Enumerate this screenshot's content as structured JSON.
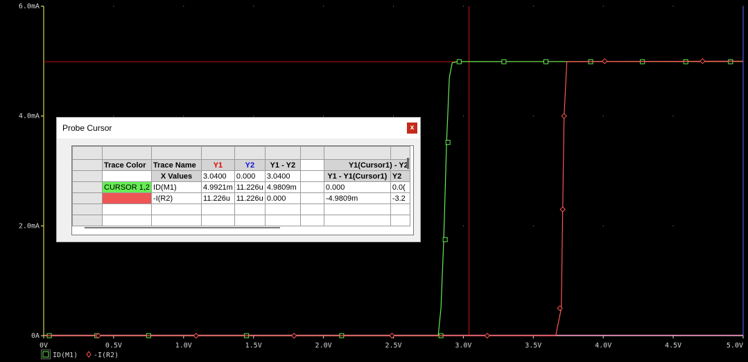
{
  "chart_data": {
    "type": "line",
    "xlim": [
      0,
      5.0
    ],
    "ylim": [
      0,
      6.0
    ],
    "x_ticks": [
      0,
      0.5,
      1.0,
      1.5,
      2.0,
      2.5,
      3.0,
      3.5,
      4.0,
      4.5,
      5.0
    ],
    "x_tick_labels": [
      "0V",
      "0.5V",
      "1.0V",
      "1.5V",
      "2.0V",
      "2.5V",
      "3.0V",
      "3.5V",
      "4.0V",
      "4.5V",
      "5.0V"
    ],
    "y_ticks": [
      0,
      2.0,
      4.0,
      6.0
    ],
    "y_tick_labels": [
      "0A",
      "2.0mA",
      "4.0mA",
      "6.0mA"
    ],
    "grid_dots": true,
    "cursors": {
      "x": 3.04,
      "y": 4.99
    },
    "series": [
      {
        "name": "ID(M1)",
        "color": "#66ee55",
        "marker": "square",
        "x": [
          0,
          2.82,
          2.84,
          2.86,
          2.88,
          2.9,
          2.92,
          2.96,
          3.04,
          5.0
        ],
        "y": [
          0,
          0,
          0.5,
          1.75,
          3.52,
          4.7,
          4.97,
          4.99,
          4.992,
          4.995
        ],
        "marker_x": [
          0.04,
          0.38,
          0.75,
          1.45,
          2.13,
          2.84,
          2.87,
          2.89,
          2.97,
          3.29,
          3.59,
          3.91,
          4.28,
          4.59,
          4.91
        ],
        "marker_y": [
          0,
          0,
          0,
          0,
          0,
          0,
          1.75,
          3.52,
          4.99,
          4.99,
          4.99,
          4.99,
          4.99,
          4.99,
          4.99
        ]
      },
      {
        "name": "-I(R2)",
        "color": "#ff5555",
        "marker": "diamond",
        "x": [
          0,
          3.66,
          3.7,
          3.71,
          3.72,
          3.74,
          5.0
        ],
        "y": [
          0,
          0,
          0.5,
          2.3,
          4.0,
          4.99,
          5.0
        ],
        "marker_x": [
          0.39,
          1.09,
          1.79,
          2.49,
          3.17,
          3.69,
          3.71,
          3.72,
          4.01,
          4.71
        ],
        "marker_y": [
          0,
          0,
          0,
          0,
          0,
          0.5,
          2.3,
          4.0,
          5.0,
          5.0
        ]
      }
    ]
  },
  "dialog": {
    "title": "Probe Cursor",
    "close_label": "x",
    "headers": {
      "trace_color": "Trace Color",
      "trace_name": "Trace Name",
      "y1": "Y1",
      "y2": "Y2",
      "y1_y2": "Y1 - Y2",
      "y1_cursor1_y2": "Y1(Cursor1) - Y2"
    },
    "subheaders": {
      "x_values": "X Values",
      "x_y1": "3.0400",
      "x_y2": "0.000",
      "x_diff": "3.0400",
      "y1_minus": "Y1 - Y1(Cursor1)",
      "y2_short": "Y2"
    },
    "rows": [
      {
        "color_label": "CURSOR 1,2",
        "name": "ID(M1)",
        "y1": "4.9921m",
        "y2": "11.226u",
        "diff": "4.9809m",
        "c1": "0.000",
        "c2": "0.0("
      },
      {
        "color_label": "",
        "name": "-I(R2)",
        "y1": "11.226u",
        "y2": "11.226u",
        "diff": "0.000",
        "c1": "-4.9809m",
        "c2": "-3.2"
      }
    ]
  },
  "colors": {
    "axis": "#ffff66",
    "cursor": "#cc1111",
    "green_trace": "#66ee55",
    "red_trace": "#ff5555",
    "pink_baseline": "#ff99cc",
    "right_axis": "#4a6cff"
  }
}
